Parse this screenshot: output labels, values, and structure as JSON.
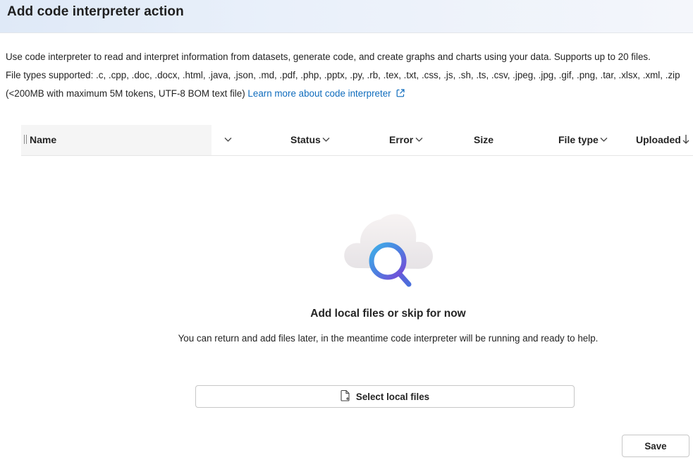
{
  "header": {
    "title": "Add code interpreter action"
  },
  "description": {
    "line1": "Use code interpreter to read and interpret information from datasets, generate code, and create graphs and charts using your data. Supports up to 20 files.",
    "line2": "File types supported: .c, .cpp, .doc, .docx, .html, .java, .json, .md, .pdf, .php, .pptx, .py, .rb, .tex, .txt, .css, .js, .sh, .ts, .csv, .jpeg, .jpg, .gif, .png, .tar, .xlsx, .xml, .zip",
    "line3": "(<200MB with maximum 5M tokens, UTF-8 BOM text file)",
    "link": "Learn more about code interpreter"
  },
  "table": {
    "columns": {
      "name": "Name",
      "status": "Status",
      "error": "Error",
      "size": "Size",
      "file_type": "File type",
      "uploaded": "Uploaded"
    }
  },
  "empty_state": {
    "title": "Add local files or skip for now",
    "subtitle": "You can return and add files later, in the meantime code interpreter will be running and ready to help.",
    "illustration": "cloud-search-icon"
  },
  "buttons": {
    "select_local": "Select local files",
    "save": "Save"
  },
  "colors": {
    "link": "#0f6cbd",
    "header_gradient_start": "#dfe9f7",
    "magnifier_gradient": [
      "#4fa3e8",
      "#6b4fd8"
    ]
  }
}
